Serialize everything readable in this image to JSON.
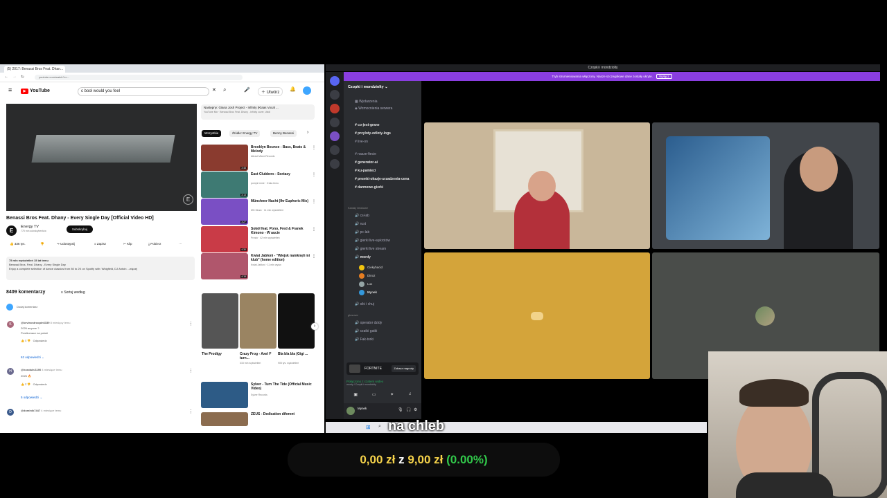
{
  "browser": {
    "tab_title": "(5) 2017: Benassi Bros Feat. Dhan...",
    "url": "youtube.com/watch?v=...",
    "search_query": "c bool would you feel"
  },
  "youtube": {
    "logo": "YouTube",
    "video_title": "Benassi Bros Feat. Dhany - Every Single Day [Official Video HD]",
    "channel": "Energy TV",
    "subscribers": "775 mln subskrybentów",
    "subscribe_label": "Subskrybuj",
    "actions": [
      "336 tys.",
      "Udostępnij",
      "Zapisz",
      "Klip",
      "Pobierz"
    ],
    "description_lines": [
      "75 mln wyświetleń  15 lat temu",
      "Benassi Bros. Feat. Dhany - Every Single Day",
      "Enjoy a complete selection of dance classics from 80 to 2K on Spotify with: Whigfield, DJ Antoin ...więcej"
    ],
    "comment_count": "8409 komentarzy",
    "sort_label": "Sortuj według",
    "add_comment": "Dodaj komentarz",
    "comments": [
      {
        "user": "@kevinostroopin6339",
        "meta": "8 miesięcy temu",
        "text1": "2026 anyone ?",
        "text2": "Przetłumacz na polski",
        "replies": "62 odpowiedzi",
        "initial": "K",
        "color": "#a8677a"
      },
      {
        "user": "@honda/n/1190",
        "meta": "4 miesiące temu",
        "text1": "2026 🔥",
        "text2": "",
        "replies": "5 odpowiedzi",
        "initial": "H",
        "color": "#6b6a8f"
      },
      {
        "user": "@dominik7447",
        "meta": "4 miesiące temu",
        "text1": "",
        "text2": "",
        "replies": "",
        "initial": "D",
        "color": "#3a5a8c"
      }
    ],
    "up_next_label": "Następny: Giana Josh Project - Infinity (Klaas Vocal ...",
    "up_next_sub": "YouTube Mix · Benassi Bros Feat. Dhany - Infinity cover, Valdi",
    "chips": [
      "Wszystkie",
      "Źródło: Energy TV",
      "Benny Benassi"
    ],
    "related": [
      {
        "title": "Brooklyn Bounce - Bass, Beats & Melody",
        "sub": "Attract Mixed Records",
        "color": "#8a3b2f",
        "dur": "3:48"
      },
      {
        "title": "East Clubbers - Sextasy",
        "sub": "pomyśl mnie · 3 lata temu",
        "color": "#3e7a73",
        "dur": "3:13"
      },
      {
        "title": "Münchner Nacht (Ihr Euphoric Mix)",
        "sub": "MG Music · 11 mln wyświetleń",
        "color": "#7a4fc4",
        "dur": "3:27"
      },
      {
        "title": "Sokół feat. Pono, Fred & Franek Kimono - W aucie",
        "sub": "Prosto · 42 mln wyświetleń",
        "color": "#c93b47",
        "dur": "4:30"
      },
      {
        "title": "Kwiat Jabłoni - \"Wiejsk namknęli mi klub\" (home edition)",
        "sub": "Kwiat Jabłoni · 11 mln wyśw.",
        "color": "#b0566c",
        "dur": "4:15"
      }
    ],
    "shorts": [
      {
        "title": "The Prodigy",
        "sub": "",
        "color": "#555"
      },
      {
        "title": "Crazy Frog - Axel F turn...",
        "sub": "315 mln wyświetleń",
        "color": "#9a8462"
      },
      {
        "title": "Bla bla bla (Gigi ...",
        "sub": "905 tys. wyświetleń",
        "color": "#111"
      }
    ],
    "related_bottom": [
      {
        "title": "Sylver - Turn The Tide (Official Music Video)",
        "sub": "Sylver Records",
        "color": "#2d5b86"
      },
      {
        "title": "ZEUS - Dedication diferent",
        "sub": "",
        "color": "#8b6c4f"
      }
    ]
  },
  "discord": {
    "window_title": "Czopki i mondziolty",
    "banner_text": "Tryb strumieniowania włączony. Nasze szczegółowe dane zostały ukryte.",
    "banner_button": "Wyłącz",
    "server_name": "Czopki i mondziolty",
    "top_items": [
      "Wydarzenia",
      "Wzmocnienia serwera"
    ],
    "text_channels": [
      "co-jest-grane",
      "przyloty-odloty-logs",
      "live-on",
      "nasze-fiecie",
      "generator-ai",
      "ku-pamieci",
      "promki-okazje-urzadzenia-cena",
      "darmowe-gierki"
    ],
    "voice_category": "Kanały tekstowe",
    "voice_channels": [
      "cs-lab",
      "rust",
      "pc-lab",
      "gierki live-wykrotów",
      "gierki live stream",
      "mordy"
    ],
    "voice_users": [
      "Ciekyhacid",
      "Dinoz",
      "Lux",
      "Mynek"
    ],
    "after_voice": [
      "siki i chuj",
      "operator dzidy",
      "czatki gatki",
      "Fak-torki"
    ],
    "voice_section": "głosowe",
    "game_name": "FORTNITE",
    "game_button": "Zobacz nagrody",
    "voice_status": "Połączono z czatem wideo",
    "voice_sub": "mordy / Czopki i mondziolty",
    "user_name": "Mynek"
  },
  "overlay": {
    "caption": "na chleb",
    "donation_current": "0,00 zł",
    "donation_of": "z",
    "donation_target": "9,00 zł",
    "donation_percent": "(0.00%)"
  },
  "colors": {
    "youtube_red": "#ff0000",
    "discord_purple": "#8a3ee0",
    "donation_green": "#31c84a",
    "donation_yellow": "#f5d24a"
  }
}
